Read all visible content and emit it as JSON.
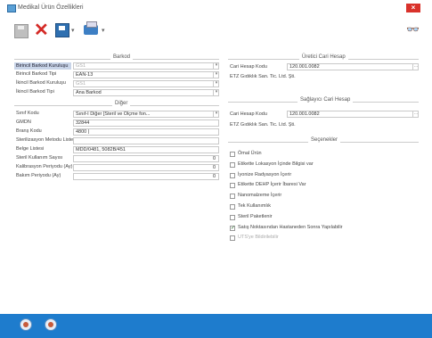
{
  "window": {
    "title": "Medikal Ürün Özellikleri",
    "close": "×"
  },
  "toolbar": {
    "delete_glyph": "✕",
    "dropdown_glyph": "▾",
    "search_glyph": "👓"
  },
  "sections": {
    "barkod": "Barkod",
    "diger": "Diğer",
    "ureticiCari": "Üretici Cari Hesap",
    "saglayiciCari": "Sağlayıcı Cari Hesap",
    "secenekler": "Seçenekler"
  },
  "barkod": {
    "rows": [
      {
        "label": "Birincil Barkod Kuruluşu",
        "value": "GS1",
        "dim": true
      },
      {
        "label": "Birincil Barkod Tipi",
        "value": "EAN-13",
        "dim": false
      },
      {
        "label": "İkincil Barkod Kuruluşu",
        "value": "GS1",
        "dim": true
      },
      {
        "label": "İkincil Barkod Tipi",
        "value": "Ana Barkod",
        "dim": false
      }
    ]
  },
  "diger": {
    "rows": [
      {
        "label": "Sınıf Kodu",
        "value": "Sınıf-I Diğer [Steril ve Ölçme fon...",
        "type": "select"
      },
      {
        "label": "GMDN",
        "value": "32844",
        "type": "text"
      },
      {
        "label": "Branş Kodu",
        "value": "4800 |",
        "type": "text"
      },
      {
        "label": "Sterilizasyon Metodu Listesi",
        "value": "",
        "type": "text"
      },
      {
        "label": "Belge Listesi",
        "value": "MDD/0481, 5082B/451",
        "type": "text"
      },
      {
        "label": "Steril Kullanım Sayısı",
        "value": "0",
        "type": "number"
      },
      {
        "label": "Kalibrasyon Periyodu (Ay)",
        "value": "0",
        "type": "number"
      },
      {
        "label": "Bakım Periyodu (Ay)",
        "value": "0",
        "type": "number"
      }
    ]
  },
  "ureticiCari": {
    "kodLabel": "Cari Hesap Kodu",
    "kodValue": "120.001.0082",
    "name": "ETZ Gıdıklık San. Tic. Ltd. Şti."
  },
  "saglayiciCari": {
    "kodLabel": "Cari Hesap Kodu",
    "kodValue": "120.001.0082",
    "name": "ETZ Gıdıklık San. Tic. Ltd. Şti."
  },
  "secenekler": [
    {
      "label": "Ömal Ürün",
      "checked": false,
      "dim": false
    },
    {
      "label": "Etikette Lokasyon İçinde Bilgisi var",
      "checked": false,
      "dim": false
    },
    {
      "label": "İyonize Radyasyon İçerir",
      "checked": false,
      "dim": false
    },
    {
      "label": "Etikette DEHP İçerir İbaresi Var",
      "checked": false,
      "dim": false
    },
    {
      "label": "Nanomalzeme İçerir",
      "checked": false,
      "dim": false
    },
    {
      "label": "Tek Kullanımlık",
      "checked": false,
      "dim": false
    },
    {
      "label": "Steril Paketlenir",
      "checked": false,
      "dim": false
    },
    {
      "label": "Satış Noktasından Hastaneden Sonra Yapılabilir",
      "checked": true,
      "dim": false
    },
    {
      "label": "UTS'ye Bildirilebilir",
      "checked": false,
      "dim": true
    }
  ],
  "colors": {
    "footer": "#1e7ccd",
    "close": "#d9322b",
    "highlight": "#c8d4e8"
  }
}
